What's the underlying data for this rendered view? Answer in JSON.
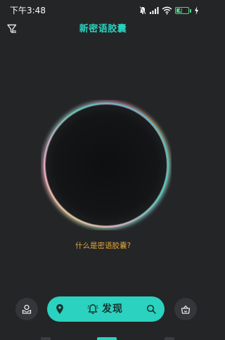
{
  "status_bar": {
    "time": "下午3:48",
    "battery_level": "49",
    "battery_fraction": 0.49,
    "icons": [
      "mute-icon",
      "signal-icon",
      "wifi-icon",
      "battery-icon",
      "charging-icon"
    ]
  },
  "header": {
    "title": "新密语胶囊",
    "filter_icon": "filter-icon"
  },
  "orb": {
    "rim_colors": [
      "#4fd6b8",
      "#f2a6c8",
      "#e9e39a",
      "#5aa9ff"
    ],
    "core_color": "#111213"
  },
  "info_link": "什么是密语胶囊?",
  "bottom_bar": {
    "left_icon": "inbox-user-icon",
    "right_icon": "capsule-bag-icon",
    "discover": {
      "label": "发现",
      "location_icon": "location-pin-icon",
      "bell_icon": "bell-icon",
      "search_icon": "search-icon"
    }
  },
  "colors": {
    "background": "#242526",
    "accent": "#2ad2bf",
    "link": "#e3a83b",
    "side_button": "#34363a"
  }
}
